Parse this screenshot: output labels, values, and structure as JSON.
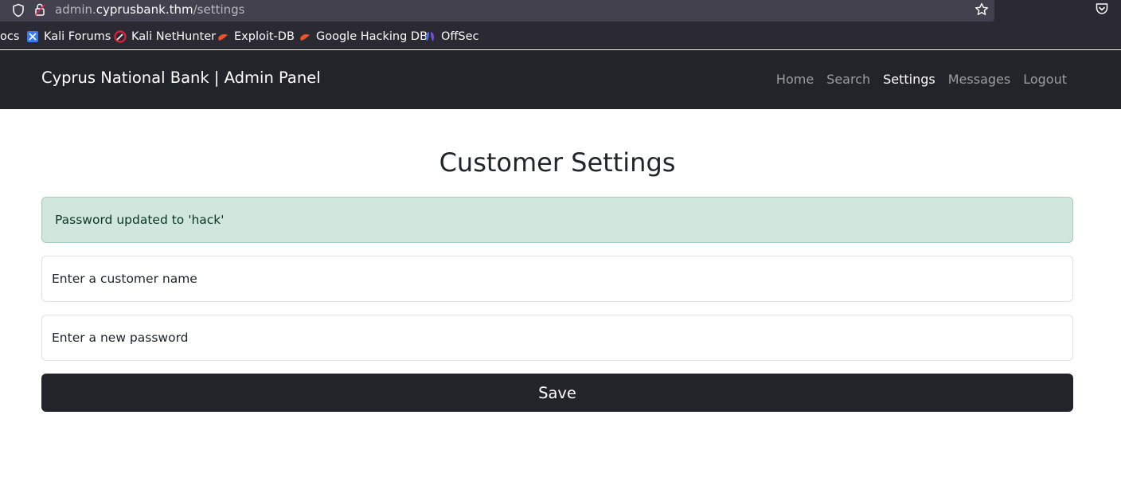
{
  "browser": {
    "url_prefix": "admin.",
    "url_host": "cyprusbank.thm",
    "url_path": "/settings",
    "bookmarks": [
      {
        "label": "ocs"
      },
      {
        "label": "Kali Forums"
      },
      {
        "label": "Kali NetHunter"
      },
      {
        "label": "Exploit-DB"
      },
      {
        "label": "Google Hacking DB"
      },
      {
        "label": "OffSec"
      }
    ]
  },
  "navbar": {
    "brand": "Cyprus National Bank | Admin Panel",
    "links": [
      {
        "label": "Home",
        "active": false
      },
      {
        "label": "Search",
        "active": false
      },
      {
        "label": "Settings",
        "active": true
      },
      {
        "label": "Messages",
        "active": false
      },
      {
        "label": "Logout",
        "active": false
      }
    ]
  },
  "main": {
    "title": "Customer Settings",
    "alert": "Password updated to 'hack'",
    "customer_name_placeholder": "Enter a customer name",
    "password_placeholder": "Enter a new password",
    "save_label": "Save"
  },
  "colors": {
    "navbar_bg": "#212529",
    "alert_bg": "#d1e7dd",
    "alert_text": "#0a3622",
    "button_bg": "#212529"
  }
}
